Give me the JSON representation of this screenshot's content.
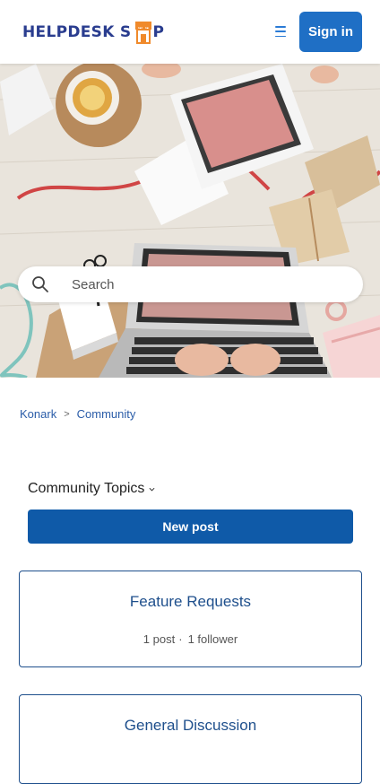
{
  "header": {
    "logo_part1": "HELPDESK S",
    "logo_part2": "P",
    "signin_label": "Sign in",
    "brand_color": "#2a3d8f",
    "accent_color": "#1f6fc5"
  },
  "hero": {
    "search_placeholder": "Search",
    "image_name": "workspace-laptop-photo"
  },
  "breadcrumb": {
    "items": [
      "Konark",
      "Community"
    ]
  },
  "topics": {
    "title": "Community Topics",
    "new_post_label": "New post"
  },
  "cards": [
    {
      "title": "Feature Requests",
      "posts": "1 post",
      "followers": "1 follower"
    },
    {
      "title": "General Discussion"
    }
  ]
}
